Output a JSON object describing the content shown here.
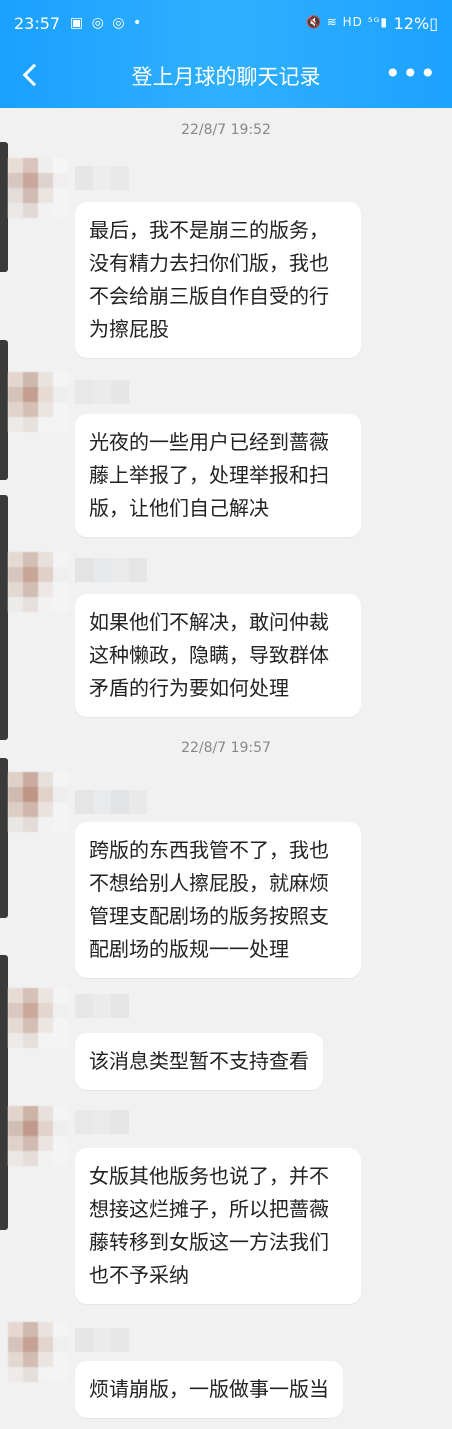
{
  "status_bar": {
    "time": "23:57",
    "left_icons": "▣ ◎ ◎ •",
    "right_icons": "🔇 ≋ HD ⁵ᴳ▮",
    "battery": "12%▯"
  },
  "header": {
    "title": "登上月球的聊天记录",
    "more_icon": "•••"
  },
  "timestamps": [
    "22/8/7 19:52",
    "22/8/7 19:57"
  ],
  "messages": [
    "最后，我不是崩三的版务，没有精力去扫你们版，我也不会给崩三版自作自受的行为擦屁股",
    "光夜的一些用户已经到蔷薇藤上举报了，处理举报和扫版，让他们自己解决",
    "如果他们不解决，敢问仲裁这种懒政，隐瞒，导致群体矛盾的行为要如何处理",
    "跨版的东西我管不了，我也不想给别人擦屁股，就麻烦管理支配剧场的版务按照支配剧场的版规一一处理",
    "该消息类型暂不支持查看",
    "女版其他版务也说了，并不想接这烂摊子，所以把蔷薇藤转移到女版这一方法我们也不予采纳",
    "烦请崩版，一版做事一版当"
  ],
  "colors": {
    "header_gradient": "#1aa0ff",
    "background": "#f1f1f1",
    "bubble": "#ffffff",
    "timestamp": "#888888"
  }
}
